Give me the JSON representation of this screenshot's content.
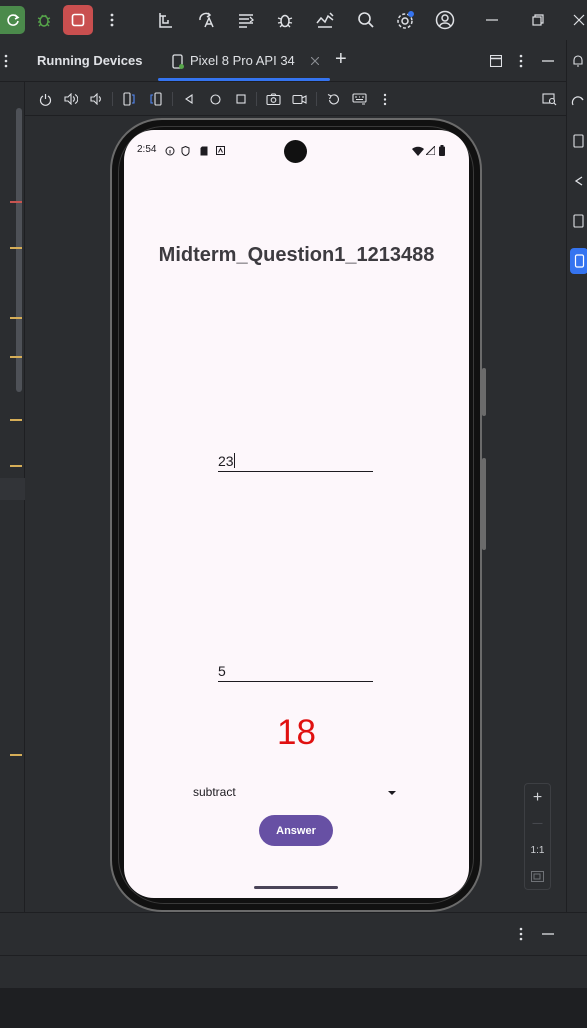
{
  "toolbar": {
    "icons": [
      "run-icon",
      "debug-icon",
      "stop-icon",
      "more-icon",
      "profiler-icon",
      "translate-icon",
      "logcat-icon",
      "bug-icon",
      "device-manager-icon",
      "search-icon",
      "settings-icon",
      "account-icon"
    ],
    "window_controls": [
      "minimize-icon",
      "restore-icon",
      "close-icon"
    ]
  },
  "panel": {
    "title": "Running Devices",
    "device_tab": "Pixel 8 Pro API 34",
    "add_tab": "+"
  },
  "phone": {
    "status": {
      "time": "2:54"
    },
    "app_title": "Midterm_Question1_1213488",
    "field1_value": "23",
    "field2_value": "5",
    "result": "18",
    "operation": "subtract",
    "answer_button": "Answer"
  },
  "zoom": {
    "plus": "+",
    "minus": "—",
    "actual": "1:1"
  },
  "colors": {
    "accent": "#6750a4",
    "result": "#e01010",
    "screen_bg": "#fdf7fb",
    "ide_bg": "#2b2d30",
    "tab_underline": "#3574f0"
  }
}
